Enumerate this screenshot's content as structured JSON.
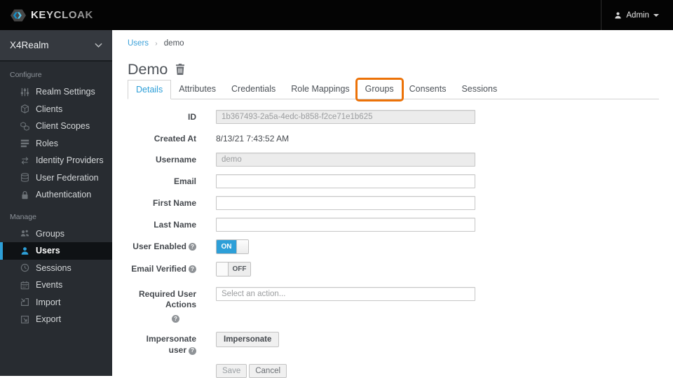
{
  "colors": {
    "accent": "#2d9fd8",
    "annotation_orange": "#ec7208"
  },
  "topbar": {
    "logo_text": "KEYCLOAK",
    "user_menu": {
      "label": "Admin",
      "icon": "user-icon"
    }
  },
  "sidebar": {
    "realm": "X4Realm",
    "sections": [
      {
        "label": "Configure",
        "items": [
          {
            "label": "Realm Settings",
            "icon": "sliders-icon"
          },
          {
            "label": "Clients",
            "icon": "cube-icon"
          },
          {
            "label": "Client Scopes",
            "icon": "cubes-icon"
          },
          {
            "label": "Roles",
            "icon": "list-icon"
          },
          {
            "label": "Identity Providers",
            "icon": "exchange-arrows-icon"
          },
          {
            "label": "User Federation",
            "icon": "database-icon"
          },
          {
            "label": "Authentication",
            "icon": "lock-icon"
          }
        ]
      },
      {
        "label": "Manage",
        "items": [
          {
            "label": "Groups",
            "icon": "group-icon"
          },
          {
            "label": "Users",
            "icon": "user-icon",
            "active": true
          },
          {
            "label": "Sessions",
            "icon": "clock-icon"
          },
          {
            "label": "Events",
            "icon": "calendar-icon"
          },
          {
            "label": "Import",
            "icon": "import-icon"
          },
          {
            "label": "Export",
            "icon": "export-icon"
          }
        ]
      }
    ]
  },
  "breadcrumb": {
    "items": [
      "Users",
      "demo"
    ],
    "separator": "›"
  },
  "page": {
    "title": "Demo",
    "delete_icon": "trash-icon"
  },
  "tabs": [
    {
      "label": "Details",
      "active": true
    },
    {
      "label": "Attributes"
    },
    {
      "label": "Credentials"
    },
    {
      "label": "Role Mappings"
    },
    {
      "label": "Groups",
      "annotated": true
    },
    {
      "label": "Consents"
    },
    {
      "label": "Sessions"
    }
  ],
  "form": {
    "help_glyph": "?",
    "fields": [
      {
        "label": "ID",
        "type": "input",
        "value": "1b367493-2a5a-4edc-b858-f2ce71e1b625",
        "disabled": true
      },
      {
        "label": "Created At",
        "type": "text",
        "value": "8/13/21 7:43:52 AM"
      },
      {
        "label": "Username",
        "type": "input",
        "value": "demo",
        "disabled": true
      },
      {
        "label": "Email",
        "type": "input",
        "value": ""
      },
      {
        "label": "First Name",
        "type": "input",
        "value": ""
      },
      {
        "label": "Last Name",
        "type": "input",
        "value": ""
      },
      {
        "label": "User Enabled",
        "help": true,
        "type": "toggle",
        "state": "ON"
      },
      {
        "label": "Email Verified",
        "help": true,
        "type": "toggle",
        "state": "OFF"
      },
      {
        "label": "Required User Actions",
        "help": true,
        "help_below": true,
        "type": "select",
        "placeholder": "Select an action..."
      },
      {
        "label": "Impersonate user",
        "help": true,
        "type": "button",
        "button_label": "Impersonate"
      }
    ],
    "actions": [
      {
        "label": "Save",
        "name": "save-button"
      },
      {
        "label": "Cancel",
        "name": "cancel-button"
      }
    ]
  }
}
